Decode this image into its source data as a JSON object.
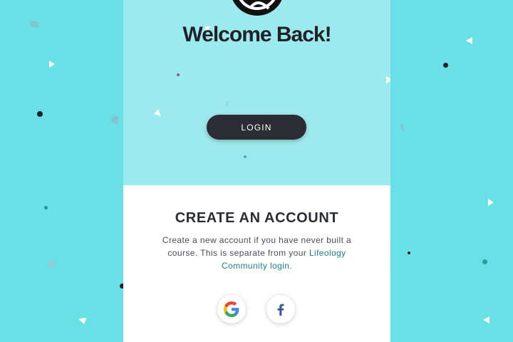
{
  "colors": {
    "page_background": "#69dfe6",
    "card_top": "#9deaee",
    "card_bottom": "#ffffff",
    "button": "#2a2d33",
    "link": "#1e7f8a"
  },
  "login_panel": {
    "logo_icon": "globe-logo-icon",
    "heading": "Welcome Back!",
    "login_button": "LOGIN"
  },
  "signup_panel": {
    "heading": "CREATE AN ACCOUNT",
    "description_prefix": "Create a new account if you have never built a course. This is separate from your ",
    "description_link": "Lifeology Community login",
    "description_suffix": ".",
    "social_buttons": [
      {
        "icon": "google-icon",
        "service": "Google"
      },
      {
        "icon": "facebook-icon",
        "service": "Facebook"
      }
    ]
  }
}
